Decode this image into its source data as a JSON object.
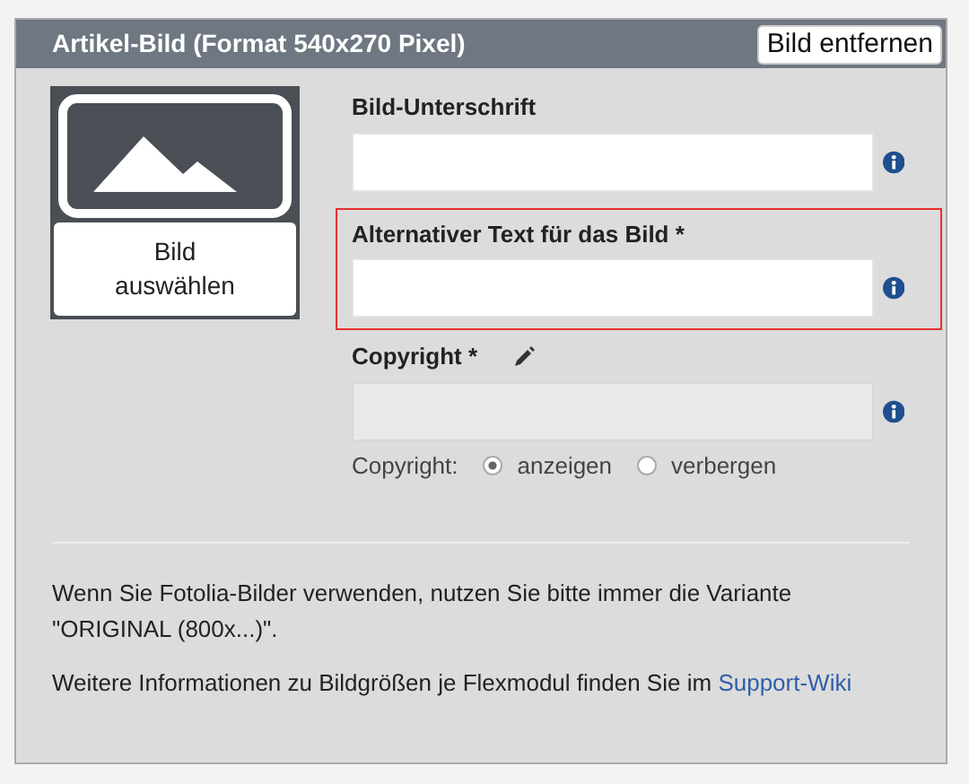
{
  "panel": {
    "title": "Artikel-Bild (Format 540x270 Pixel)",
    "remove_button": "Bild entfernen"
  },
  "image_picker": {
    "button": "Bild auswählen"
  },
  "fields": [
    {
      "kind": "text",
      "label": "Bild-Unterschrift",
      "highlighted": false,
      "editable_icon": false
    },
    {
      "kind": "text",
      "label": "Alternativer Text für das Bild *",
      "highlighted": true,
      "editable_icon": false
    },
    {
      "kind": "readonly",
      "label": "Copyright *",
      "highlighted": false,
      "editable_icon": true
    }
  ],
  "copyright_display": {
    "label": "Copyright:",
    "options": [
      {
        "label": "anzeigen",
        "selected": true
      },
      {
        "label": "verbergen",
        "selected": false
      }
    ]
  },
  "notes": [
    {
      "text": "Wenn Sie Fotolia-Bilder verwenden, nutzen Sie bitte immer die Variante \"ORIGINAL (800x...)\"."
    },
    {
      "text": "Weitere Informationen zu Bildgrößen je Flexmodul finden Sie im",
      "link": "Support-Wiki"
    }
  ]
}
